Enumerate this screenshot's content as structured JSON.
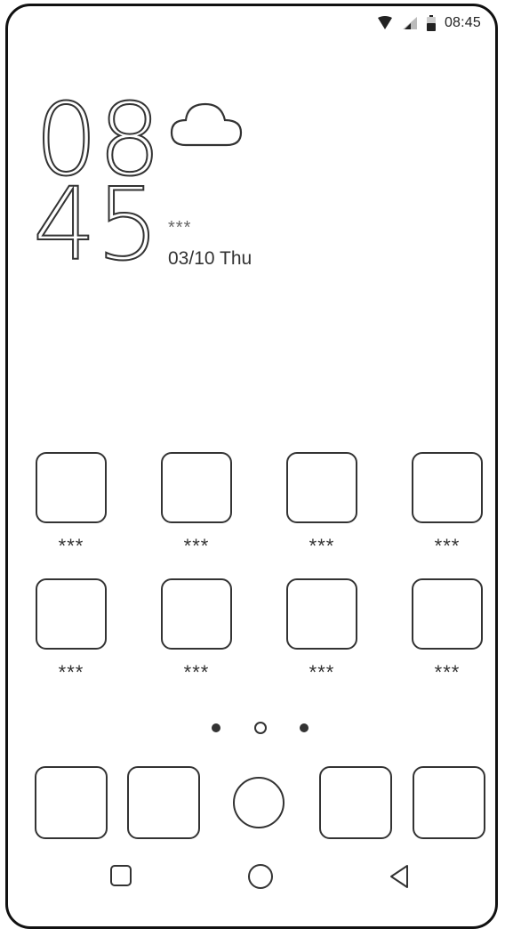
{
  "status_bar": {
    "time": "08:45",
    "icons": [
      "wifi-icon",
      "cellular-signal-icon",
      "battery-icon"
    ]
  },
  "clock": {
    "hours": "08",
    "minutes": "45",
    "weather_icon": "cloud-icon",
    "temperature": "***",
    "date": "03/10 Thu"
  },
  "apps": [
    {
      "label": "***"
    },
    {
      "label": "***"
    },
    {
      "label": "***"
    },
    {
      "label": "***"
    },
    {
      "label": "***"
    },
    {
      "label": "***"
    },
    {
      "label": "***"
    },
    {
      "label": "***"
    }
  ],
  "page_indicator": {
    "pages": 3,
    "current": 2
  },
  "dock": {
    "items": [
      "app-icon",
      "app-icon",
      "home-circle-icon",
      "app-icon",
      "app-icon"
    ]
  },
  "nav_bar": {
    "buttons": [
      "recents-square-icon",
      "home-circle-icon",
      "back-triangle-icon"
    ]
  }
}
